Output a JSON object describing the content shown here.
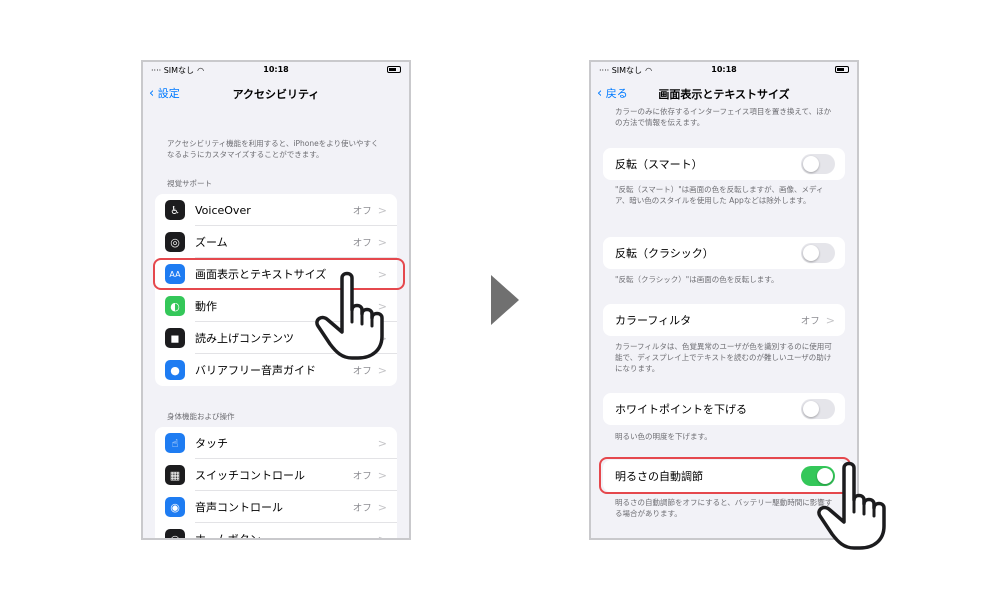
{
  "left": {
    "status": {
      "carrier": "···· SIMなし",
      "time": "10:18"
    },
    "nav": {
      "back": "設定",
      "title": "アクセシビリティ"
    },
    "intro": "アクセシビリティ機能を利用すると、iPhoneをより使いやすくなるようにカスタマイズすることができます。",
    "vision_header": "視覚サポート",
    "vision_items": [
      {
        "label": "VoiceOver",
        "value": "オフ",
        "icon": "voiceover-icon",
        "color": "#1c1c1e"
      },
      {
        "label": "ズーム",
        "value": "オフ",
        "icon": "zoom-icon",
        "color": "#1c1c1e"
      },
      {
        "label": "画面表示とテキストサイズ",
        "value": "",
        "icon": "display-text-size-icon",
        "color": "#1e7cf2"
      },
      {
        "label": "動作",
        "value": "",
        "icon": "motion-icon",
        "color": "#34c759"
      },
      {
        "label": "読み上げコンテンツ",
        "value": "",
        "icon": "spoken-content-icon",
        "color": "#1c1c1e"
      },
      {
        "label": "バリアフリー音声ガイド",
        "value": "オフ",
        "icon": "audio-description-icon",
        "color": "#1e7cf2"
      }
    ],
    "physical_header": "身体機能および操作",
    "physical_items": [
      {
        "label": "タッチ",
        "value": "",
        "icon": "touch-icon",
        "color": "#1e7cf2"
      },
      {
        "label": "スイッチコントロール",
        "value": "オフ",
        "icon": "switch-control-icon",
        "color": "#1c1c1e"
      },
      {
        "label": "音声コントロール",
        "value": "オフ",
        "icon": "voice-control-icon",
        "color": "#1e7cf2"
      },
      {
        "label": "ホームボタン",
        "value": "",
        "icon": "home-button-icon",
        "color": "#1c1c1e"
      }
    ]
  },
  "right": {
    "status": {
      "carrier": "···· SIMなし",
      "time": "10:18"
    },
    "nav": {
      "back": "戻る",
      "title": "画面表示とテキストサイズ"
    },
    "top_note": "カラーのみに依存するインターフェイス項目を置き換えて、ほかの方法で情報を伝えます。",
    "smart_invert": {
      "label": "反転（スマート）",
      "on": false
    },
    "smart_invert_note": "\"反転（スマート）\"は画面の色を反転しますが、画像、メディア、暗い色のスタイルを使用した Appなどは除外します。",
    "classic_invert": {
      "label": "反転（クラシック）",
      "on": false
    },
    "classic_invert_note": "\"反転（クラシック）\"は画面の色を反転します。",
    "color_filters": {
      "label": "カラーフィルタ",
      "value": "オフ"
    },
    "color_filters_note": "カラーフィルタは、色覚異常のユーザが色を識別するのに使用可能で、ディスプレイ上でテキストを読むのが難しいユーザの助けになります。",
    "reduce_white": {
      "label": "ホワイトポイントを下げる",
      "on": false
    },
    "reduce_white_note": "明るい色の明度を下げます。",
    "auto_brightness": {
      "label": "明るさの自動調節",
      "on": true
    },
    "auto_brightness_note": "明るさの自動調節をオフにすると、バッテリー駆動時間に影響する場合があります。"
  },
  "colors": {
    "highlight": "#e5484d",
    "toggle_on": "#34c759",
    "accent": "#007aff"
  }
}
